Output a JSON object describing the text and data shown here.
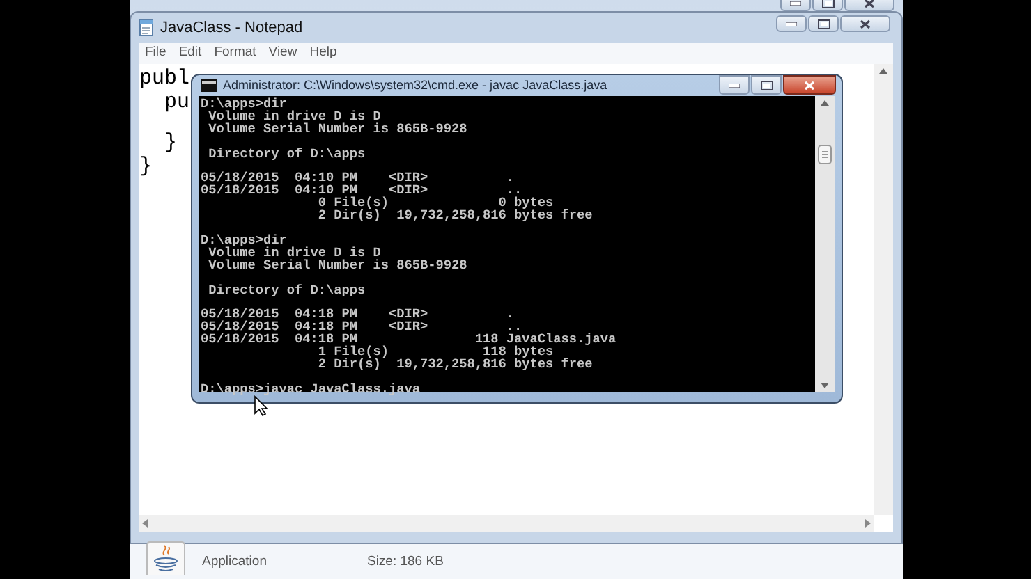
{
  "notepad": {
    "title": "JavaClass - Notepad",
    "menu": [
      "File",
      "Edit",
      "Format",
      "View",
      "Help"
    ],
    "text_blocks": [
      [
        "publ",
        "  pu"
      ],
      [
        "  }",
        "}"
      ]
    ]
  },
  "console": {
    "title": "Administrator: C:\\Windows\\system32\\cmd.exe - javac  JavaClass.java",
    "blocks": [
      [
        "D:\\apps>dir",
        " Volume in drive D is D",
        " Volume Serial Number is 865B-9928"
      ],
      [
        " Directory of D:\\apps"
      ],
      [
        "05/18/2015  04:10 PM    <DIR>          .",
        "05/18/2015  04:10 PM    <DIR>          ..",
        "               0 File(s)              0 bytes",
        "               2 Dir(s)  19,732,258,816 bytes free"
      ],
      [
        "D:\\apps>dir",
        " Volume in drive D is D",
        " Volume Serial Number is 865B-9928"
      ],
      [
        " Directory of D:\\apps"
      ],
      [
        "05/18/2015  04:18 PM    <DIR>          .",
        "05/18/2015  04:18 PM    <DIR>          ..",
        "05/18/2015  04:18 PM               118 JavaClass.java",
        "               1 File(s)            118 bytes",
        "               2 Dir(s)  19,732,258,816 bytes free"
      ],
      [
        "D:\\apps>javac JavaClass.java"
      ]
    ]
  },
  "details": {
    "type": "Application",
    "size": "Size: 186 KB"
  }
}
